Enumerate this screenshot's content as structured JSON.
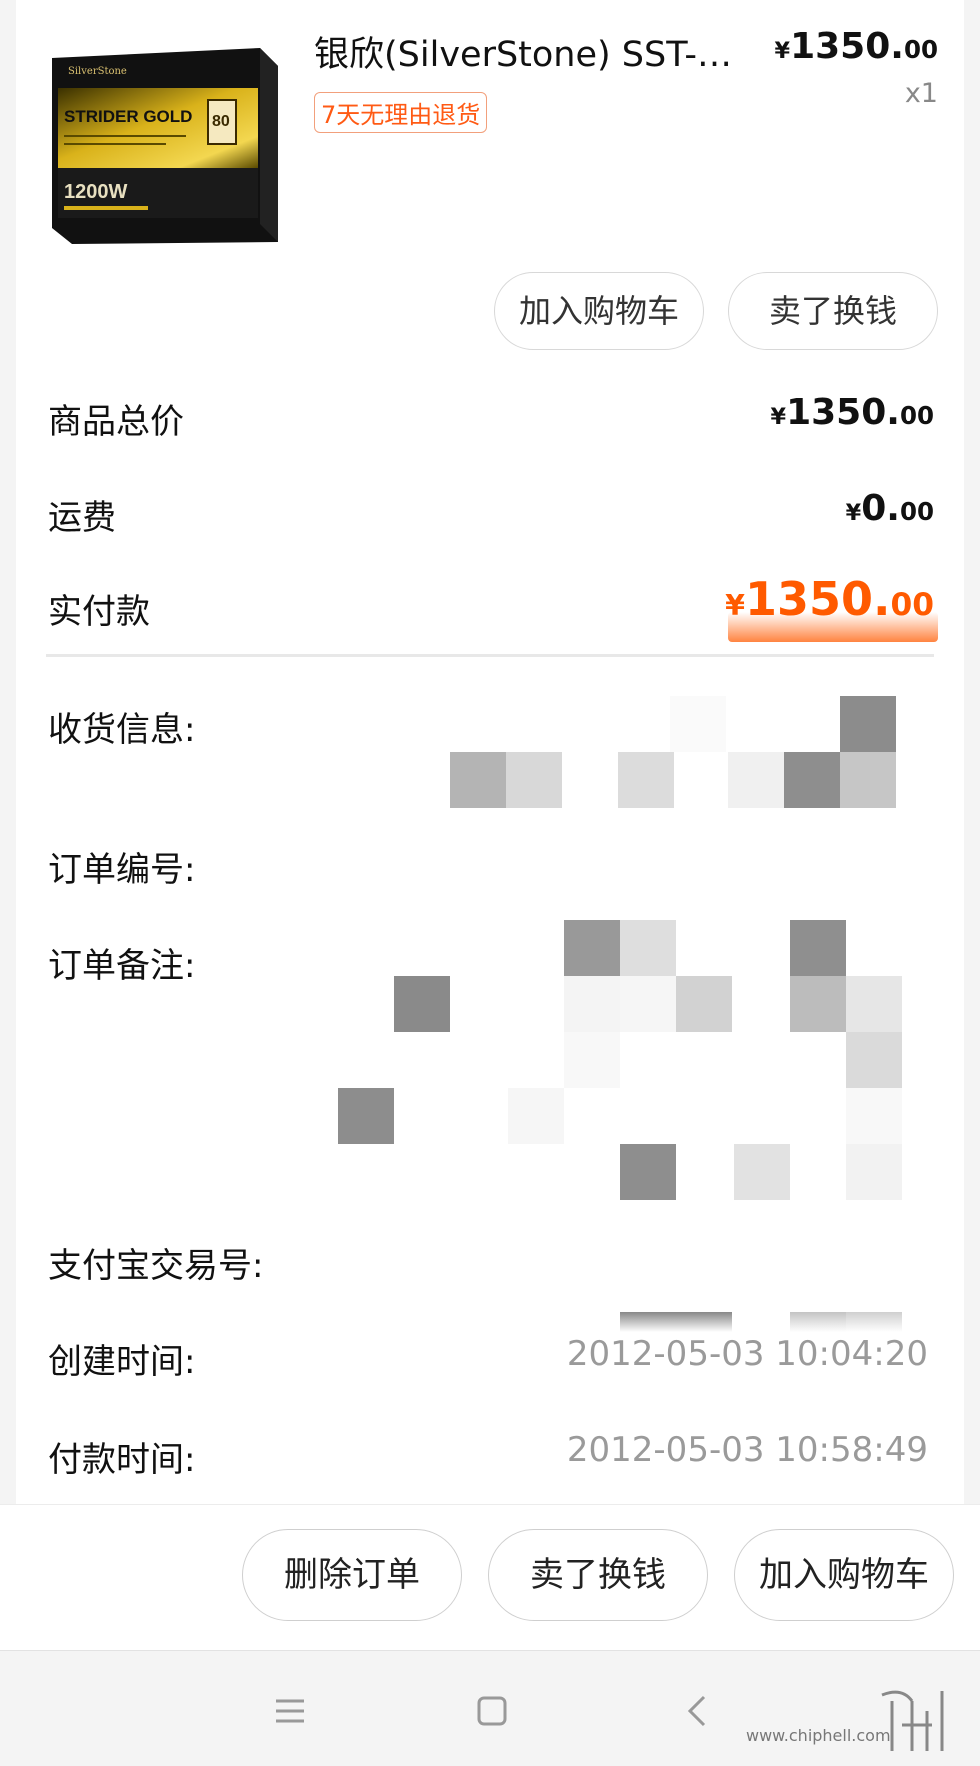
{
  "product": {
    "title": "银欣(SilverStone) SST-…",
    "badge": "7天无理由退货",
    "price_currency": "¥",
    "price_int": "1350.",
    "price_cents": "00",
    "quantity": "x1",
    "box_text": {
      "brand": "SilverStone",
      "model": "STRIDER GOLD",
      "wattage": "1200W",
      "rating": "80"
    }
  },
  "item_actions": {
    "add_to_cart": "加入购物车",
    "sell": "卖了换钱"
  },
  "summary": {
    "goods_total_label": "商品总价",
    "goods_total_cur": "¥",
    "goods_total_int": "1350.",
    "goods_total_cents": "00",
    "shipping_label": "运费",
    "shipping_cur": "¥",
    "shipping_int": "0.",
    "shipping_cents": "00",
    "paid_label": "实付款",
    "paid_cur": "¥",
    "paid_int": "1350.",
    "paid_cents": "00"
  },
  "info": {
    "shipping_info_label": "收货信息:",
    "order_no_label": "订单编号:",
    "order_note_label": "订单备注:",
    "alipay_label": "支付宝交易号:",
    "created_label": "创建时间:",
    "created_value": "2012-05-03 10:04:20",
    "paid_time_label": "付款时间:",
    "paid_time_value": "2012-05-03 10:58:49"
  },
  "bottom_actions": {
    "delete": "删除订单",
    "sell": "卖了换钱",
    "add_to_cart": "加入购物车"
  },
  "watermark": "www.chiphell.com",
  "colors": {
    "accent": "#ff5a00",
    "badge_border": "#f2a07c",
    "muted": "#9a9a9a"
  }
}
